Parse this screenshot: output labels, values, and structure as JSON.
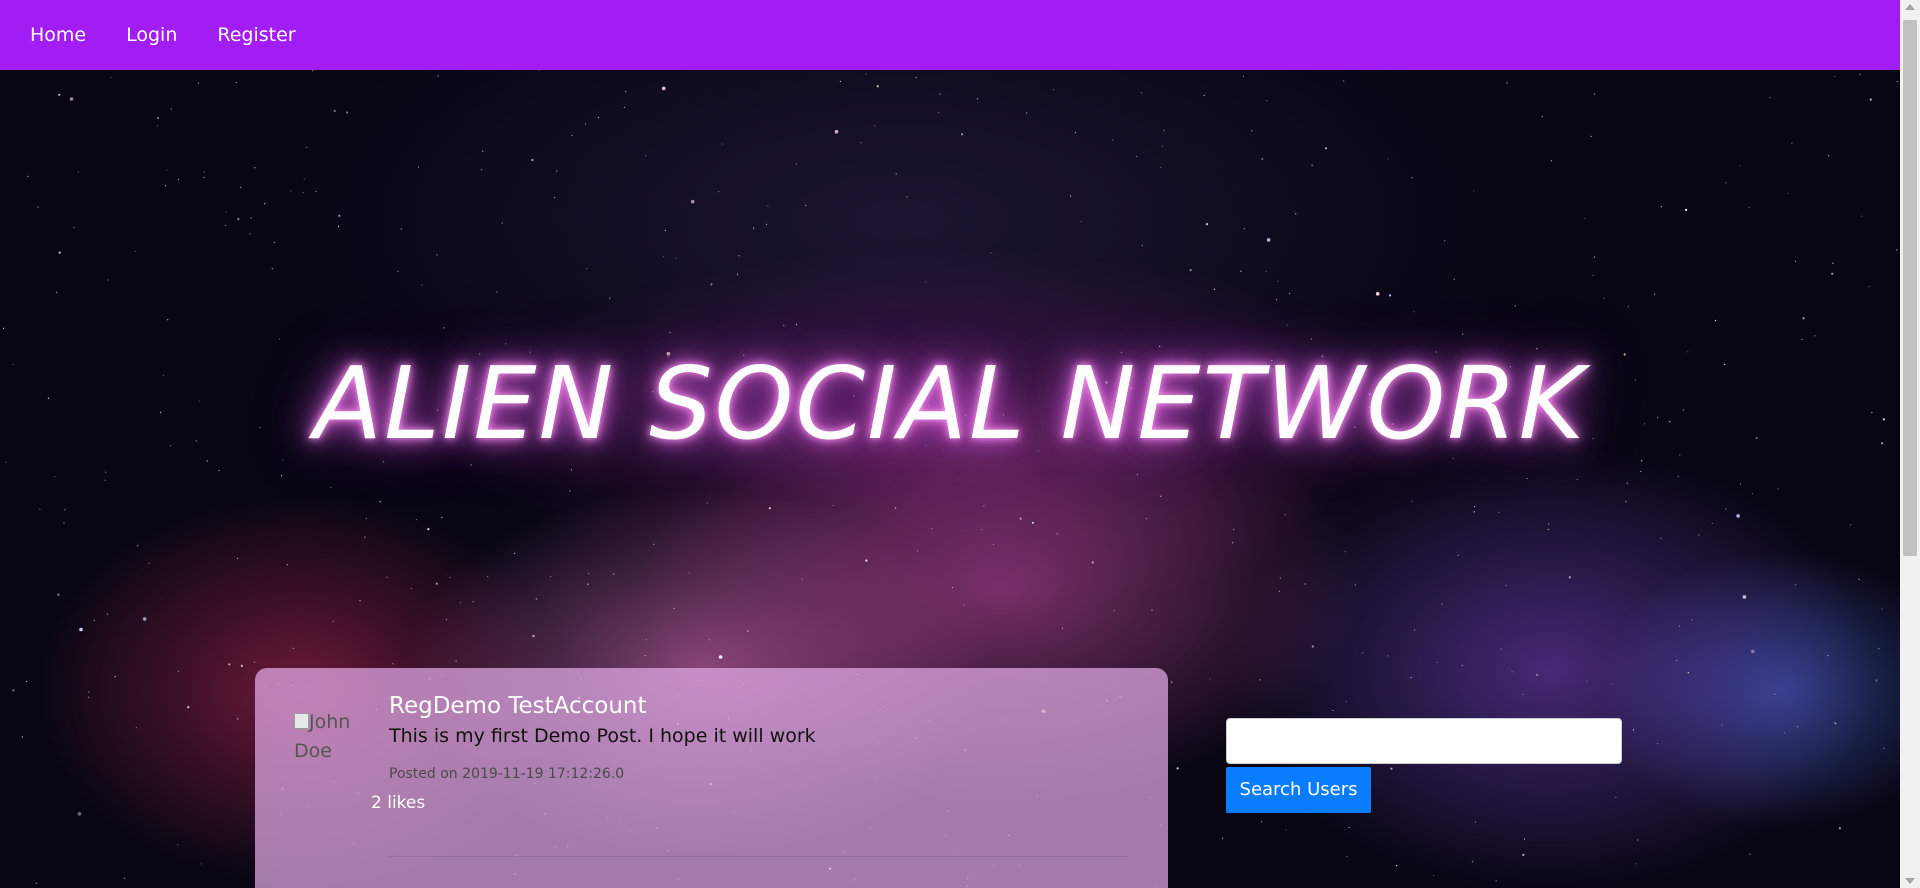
{
  "nav": {
    "items": [
      {
        "label": "Home"
      },
      {
        "label": "Login"
      },
      {
        "label": "Register"
      }
    ],
    "background_color": "#a21cf4"
  },
  "hero": {
    "title": "ALIEN SOCIAL NETWORK",
    "title_glow_color": "#e66ddc"
  },
  "post": {
    "author": "RegDemo TestAccount",
    "avatar_alt": "John Doe",
    "body": "This is my first Demo Post. I hope it will work",
    "posted_on": "Posted on 2019-11-19 17:12:26.0",
    "likes": "2 likes"
  },
  "search": {
    "value": "",
    "placeholder": "",
    "button_label": "Search Users",
    "button_color": "#0a7cff"
  }
}
